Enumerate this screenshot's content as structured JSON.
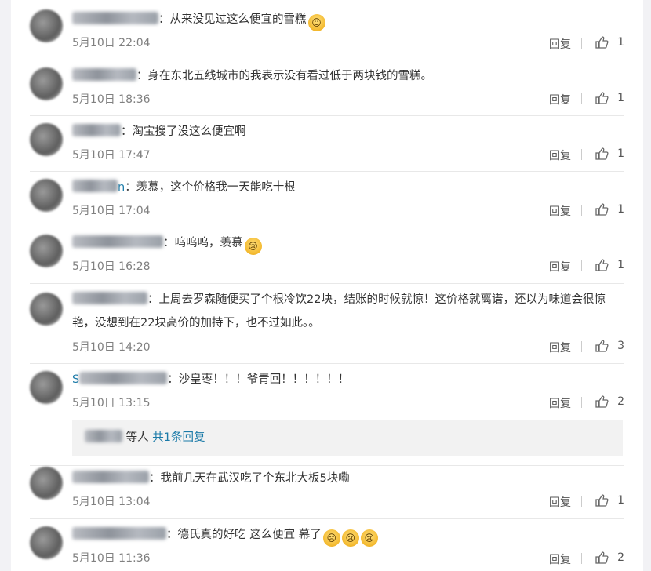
{
  "comments": [
    {
      "text": "从来没见过这么便宜的雪糕",
      "emoji": "smile",
      "time": "5月10日 22:04",
      "reply": "回复",
      "likes": "1"
    },
    {
      "text": "身在东北五线城市的我表示没有看过低于两块钱的雪糕。",
      "time": "5月10日 18:36",
      "reply": "回复",
      "likes": "1"
    },
    {
      "text": "淘宝搜了没这么便宜啊",
      "time": "5月10日 17:47",
      "reply": "回复",
      "likes": "1"
    },
    {
      "text": "羡慕，这个价格我一天能吃十根",
      "name_tail": "n",
      "time": "5月10日 17:04",
      "reply": "回复",
      "likes": "1"
    },
    {
      "text": "呜呜呜，羡慕",
      "emoji": "cry",
      "time": "5月10日 16:28",
      "reply": "回复",
      "likes": "1"
    },
    {
      "text": "上周去罗森随便买了个根冷饮22块，结账的时候就惊！这价格就离谱，还以为味道会很惊艳，没想到在22块高价的加持下，也不过如此。。",
      "time": "5月10日 14:20",
      "reply": "回复",
      "likes": "3"
    },
    {
      "text": "沙皇枣！！！爷青回！！！！！！",
      "name_head": "S",
      "time": "5月10日 13:15",
      "reply": "回复",
      "likes": "2"
    },
    {
      "text": "我前几天在武汉吃了个东北大板5块嘞",
      "time": "5月10日 13:04",
      "reply": "回复",
      "likes": "1"
    },
    {
      "text": "德氏真的好吃 这么便宜 幕了",
      "emoji": "cry3",
      "time": "5月10日 11:36",
      "reply": "回复",
      "likes": "2"
    }
  ],
  "sub_replies": {
    "suffix": "等人",
    "link": "共1条回复"
  },
  "colon": "：",
  "colors": {
    "link": "#1a7aa8",
    "time": "#808080",
    "divider": "#e8e8e8"
  },
  "icons": [
    "thumbs-up-icon",
    "smile-emoji-icon",
    "cry-emoji-icon"
  ]
}
